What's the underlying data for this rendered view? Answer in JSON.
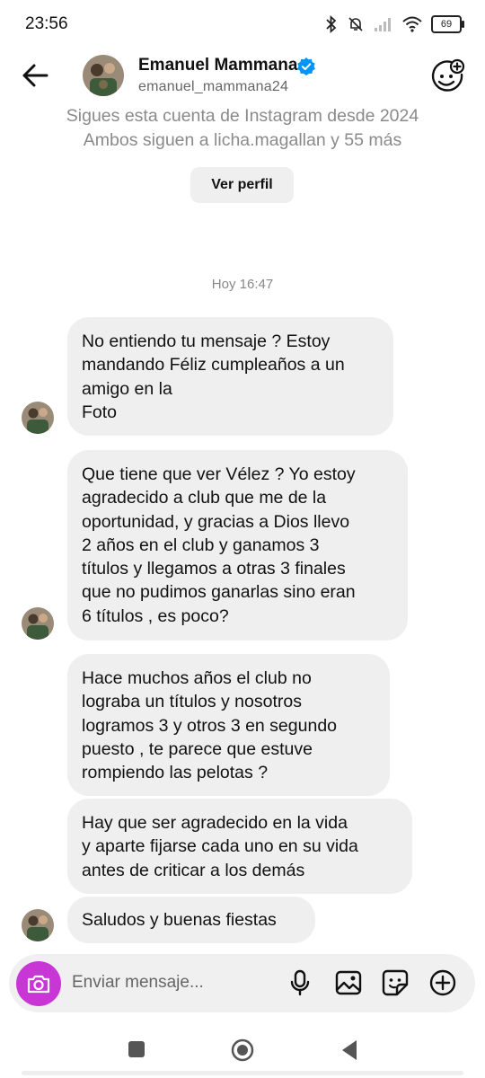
{
  "status_bar": {
    "time": "23:56",
    "battery": "69"
  },
  "header": {
    "name": "Emanuel Mammana",
    "username": "emanuel_mammana24",
    "verified": true
  },
  "profile_info": {
    "line1": "Sigues esta cuenta de Instagram desde 2024",
    "line2": "Ambos siguen a licha.magallan y 55 más",
    "view_profile_label": "Ver perfil"
  },
  "conversation": {
    "time_separator": "Hoy 16:47",
    "messages": [
      {
        "text": "No entiendo tu mensaje ? Estoy\nmandando Féliz cumpleaños a un\namigo en la\nFoto",
        "show_avatar": true
      },
      {
        "text": "Que tiene que ver Vélez ? Yo estoy\nagradecido a club que  me de la\noportunidad, y gracias a Dios llevo\n2 años en el club y ganamos 3\ntítulos y llegamos a otras 3 finales\nque no pudimos ganarlas sino eran\n6 títulos , es poco?",
        "show_avatar": true
      },
      {
        "text": "Hace muchos años el club no\nlograba un títulos y nosotros\nlogramos 3 y otros 3 en segundo\npuesto , te parece que estuve\nrompiendo las pelotas ?",
        "show_avatar": false
      },
      {
        "text": "Hay que ser agradecido en la vida\ny aparte fijarse cada uno en su vida\nantes de criticar a los demás",
        "show_avatar": false
      },
      {
        "text": "Saludos y buenas fiestas",
        "show_avatar": true
      }
    ]
  },
  "composer": {
    "placeholder": "Enviar mensaje..."
  },
  "icons": {
    "back": "arrow-left-icon",
    "effects": "sticker-face-plus-icon",
    "camera": "camera-icon",
    "mic": "microphone-icon",
    "gallery": "image-icon",
    "sticker": "sticker-icon",
    "add": "plus-circle-icon"
  },
  "colors": {
    "camera_button": "#c837d6",
    "verified": "#0095f6",
    "bubble": "#efefef"
  }
}
